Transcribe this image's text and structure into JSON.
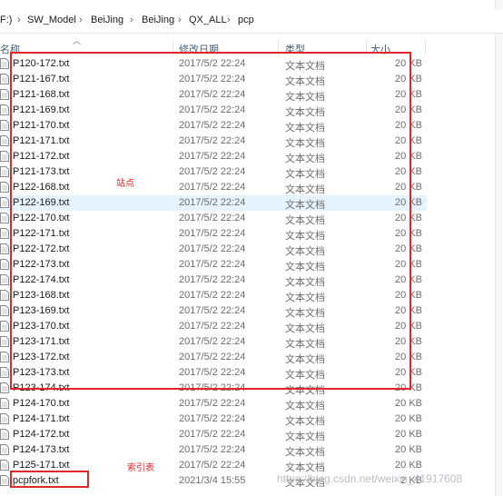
{
  "breadcrumb": {
    "items": [
      "F:)",
      "SW_Model",
      "BeiJing",
      "BeiJing",
      "QX_ALL",
      "pcp"
    ],
    "separator": "›"
  },
  "columns": {
    "name": "名称",
    "date": "修改日期",
    "type": "类型",
    "size": "大小"
  },
  "files": [
    {
      "name": "P120-172.txt",
      "date": "2017/5/2 22:24",
      "type": "文本文档",
      "size": "20 KB"
    },
    {
      "name": "P121-167.txt",
      "date": "2017/5/2 22:24",
      "type": "文本文档",
      "size": "20 KB"
    },
    {
      "name": "P121-168.txt",
      "date": "2017/5/2 22:24",
      "type": "文本文档",
      "size": "20 KB"
    },
    {
      "name": "P121-169.txt",
      "date": "2017/5/2 22:24",
      "type": "文本文档",
      "size": "20 KB"
    },
    {
      "name": "P121-170.txt",
      "date": "2017/5/2 22:24",
      "type": "文本文档",
      "size": "20 KB"
    },
    {
      "name": "P121-171.txt",
      "date": "2017/5/2 22:24",
      "type": "文本文档",
      "size": "20 KB"
    },
    {
      "name": "P121-172.txt",
      "date": "2017/5/2 22:24",
      "type": "文本文档",
      "size": "20 KB"
    },
    {
      "name": "P121-173.txt",
      "date": "2017/5/2 22:24",
      "type": "文本文档",
      "size": "20 KB"
    },
    {
      "name": "P122-168.txt",
      "date": "2017/5/2 22:24",
      "type": "文本文档",
      "size": "20 KB"
    },
    {
      "name": "P122-169.txt",
      "date": "2017/5/2 22:24",
      "type": "文本文档",
      "size": "20 KB"
    },
    {
      "name": "P122-170.txt",
      "date": "2017/5/2 22:24",
      "type": "文本文档",
      "size": "20 KB"
    },
    {
      "name": "P122-171.txt",
      "date": "2017/5/2 22:24",
      "type": "文本文档",
      "size": "20 KB"
    },
    {
      "name": "P122-172.txt",
      "date": "2017/5/2 22:24",
      "type": "文本文档",
      "size": "20 KB"
    },
    {
      "name": "P122-173.txt",
      "date": "2017/5/2 22:24",
      "type": "文本文档",
      "size": "20 KB"
    },
    {
      "name": "P122-174.txt",
      "date": "2017/5/2 22:24",
      "type": "文本文档",
      "size": "20 KB"
    },
    {
      "name": "P123-168.txt",
      "date": "2017/5/2 22:24",
      "type": "文本文档",
      "size": "20 KB"
    },
    {
      "name": "P123-169.txt",
      "date": "2017/5/2 22:24",
      "type": "文本文档",
      "size": "20 KB"
    },
    {
      "name": "P123-170.txt",
      "date": "2017/5/2 22:24",
      "type": "文本文档",
      "size": "20 KB"
    },
    {
      "name": "P123-171.txt",
      "date": "2017/5/2 22:24",
      "type": "文本文档",
      "size": "20 KB"
    },
    {
      "name": "P123-172.txt",
      "date": "2017/5/2 22:24",
      "type": "文本文档",
      "size": "20 KB"
    },
    {
      "name": "P123-173.txt",
      "date": "2017/5/2 22:24",
      "type": "文本文档",
      "size": "20 KB"
    },
    {
      "name": "P123-174.txt",
      "date": "2017/5/2 22:24",
      "type": "文本文档",
      "size": "20 KB"
    },
    {
      "name": "P124-170.txt",
      "date": "2017/5/2 22:24",
      "type": "文本文档",
      "size": "20 KB"
    },
    {
      "name": "P124-171.txt",
      "date": "2017/5/2 22:24",
      "type": "文本文档",
      "size": "20 KB"
    },
    {
      "name": "P124-172.txt",
      "date": "2017/5/2 22:24",
      "type": "文本文档",
      "size": "20 KB"
    },
    {
      "name": "P124-173.txt",
      "date": "2017/5/2 22:24",
      "type": "文本文档",
      "size": "20 KB"
    },
    {
      "name": "P125-171.txt",
      "date": "2017/5/2 22:24",
      "type": "文本文档",
      "size": "20 KB"
    },
    {
      "name": "pcpfork.txt",
      "date": "2021/3/4 15:55",
      "type": "文本文档",
      "size": "2 KB"
    }
  ],
  "annotations": {
    "stations_label": "站点",
    "index_label": "索引表",
    "color": "#e3262c"
  },
  "watermark": "https://blog.csdn.net/weixin_41917608",
  "colors": {
    "hover_row": "#e5f3ff",
    "header_text": "#4c607a"
  }
}
